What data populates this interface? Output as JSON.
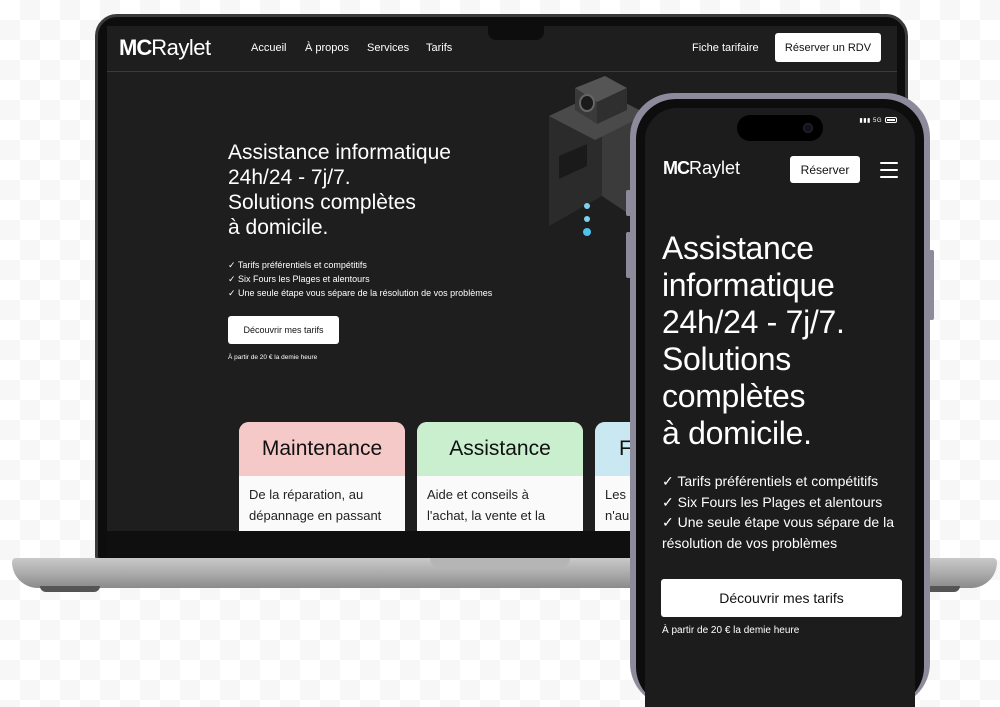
{
  "brand": {
    "logo_text_mc": "MC",
    "logo_text_rest": "Raylet"
  },
  "desktop": {
    "nav": {
      "links": [
        "Accueil",
        "À propos",
        "Services",
        "Tarifs"
      ],
      "fiche": "Fiche tarifaire",
      "cta": "Réserver un RDV"
    },
    "hero": {
      "title_lines": [
        "Assistance informatique",
        "24h/24 - 7j/7.",
        "Solutions complètes",
        "à domicile."
      ],
      "bullets": [
        "✓  Tarifs préférentiels et compétitifs",
        "✓  Six Fours les Plages et alentours",
        "✓  Une seule étape vous sépare de la résolution de vos problèmes"
      ],
      "button": "Découvrir mes tarifs",
      "note": "À partir de 20 € la demie heure"
    },
    "cards": [
      {
        "title": "Maintenance",
        "desc_lines": [
          "De la réparation, au",
          "dépannage en passant"
        ],
        "color": "#f6c9c9"
      },
      {
        "title": "Assistance",
        "desc_lines": [
          "Aide et conseils à",
          "l'achat, la vente et la"
        ],
        "color": "#c9efcf"
      },
      {
        "title": "F",
        "desc_lines": [
          "Les c",
          "n'aur"
        ],
        "color": "#c9e8f2"
      }
    ]
  },
  "phone": {
    "status": "5G",
    "cta": "Réserver",
    "title_lines": [
      "Assistance",
      "informatique",
      "24h/24 - 7j/7.",
      "Solutions",
      "complètes",
      "à domicile."
    ],
    "bullets": [
      "✓  Tarifs préférentiels et compétitifs",
      "✓  Six Fours les Plages et alentours",
      "✓  Une seule étape vous sépare de la résolution de vos problèmes"
    ],
    "button": "Découvrir mes tarifs",
    "note": "À partir de 20 € la demie heure"
  },
  "icons": {
    "menu": "hamburger-menu-icon",
    "camera": "camera-icon",
    "battery": "battery-icon"
  }
}
